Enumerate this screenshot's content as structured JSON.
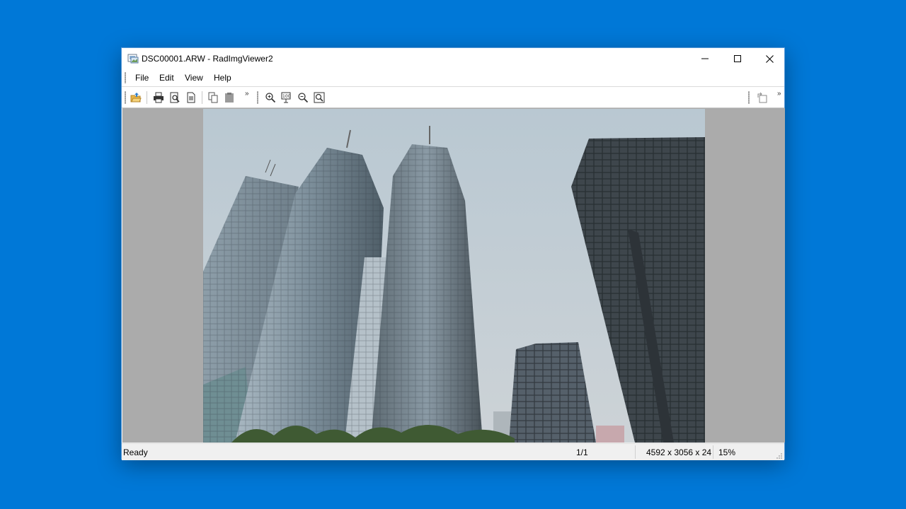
{
  "window": {
    "title": "DSC00001.ARW - RadImgViewer2"
  },
  "menu": {
    "items": [
      {
        "label": "File"
      },
      {
        "label": "Edit"
      },
      {
        "label": "View"
      },
      {
        "label": "Help"
      }
    ]
  },
  "toolbar": {
    "buttons": [
      {
        "icon": "open-icon"
      },
      {
        "icon": "print-icon"
      },
      {
        "icon": "print-preview-icon"
      },
      {
        "icon": "page-setup-icon"
      },
      {
        "icon": "copy-icon"
      },
      {
        "icon": "paste-icon"
      },
      {
        "icon": "zoom-in-icon"
      },
      {
        "icon": "actual-size-icon"
      },
      {
        "icon": "zoom-out-icon"
      },
      {
        "icon": "fit-window-icon"
      },
      {
        "icon": "rotate-icon"
      }
    ],
    "overflow_glyph": "»"
  },
  "image": {
    "description_icon": "photo-icon"
  },
  "status": {
    "message": "Ready",
    "page": "1/1",
    "dimensions": "4592 x 3056 x 24",
    "zoom": "15%"
  },
  "colors": {
    "desktop": "#0078d7",
    "viewport": "#ababab",
    "sky": "#b9c8d2"
  }
}
